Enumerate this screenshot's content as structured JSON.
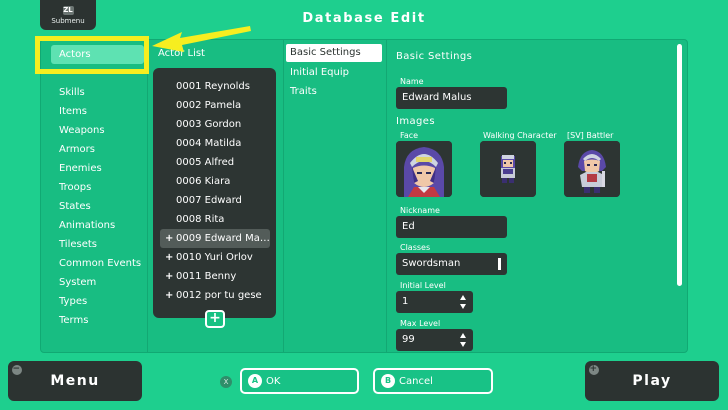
{
  "header": {
    "submenu_key": "ZL",
    "submenu_label": "Submenu",
    "title": "Database Edit"
  },
  "categories": {
    "active": "Actors",
    "items": [
      "Skills",
      "Items",
      "Weapons",
      "Armors",
      "Enemies",
      "Troops",
      "States",
      "Animations",
      "Tilesets",
      "Common Events",
      "System",
      "Types",
      "Terms"
    ]
  },
  "actor_list": {
    "title": "Actor List",
    "items": [
      {
        "label": "0001 Reynolds"
      },
      {
        "label": "0002 Pamela"
      },
      {
        "label": "0003 Gordon"
      },
      {
        "label": "0004 Matilda"
      },
      {
        "label": "0005 Alfred"
      },
      {
        "label": "0006 Kiara"
      },
      {
        "label": "0007 Edward"
      },
      {
        "label": "0008 Rita"
      },
      {
        "label": "0009 Edward Ma…",
        "prefix": "+"
      },
      {
        "label": "0010 Yuri Orlov",
        "prefix": "+"
      },
      {
        "label": "0011 Benny",
        "prefix": "+"
      },
      {
        "label": "0012 por tu gese",
        "prefix": "+"
      }
    ],
    "add_label": "+"
  },
  "tabs": {
    "basic": "Basic Settings",
    "equip": "Initial Equip",
    "traits": "Traits"
  },
  "settings": {
    "title": "Basic Settings",
    "name_label": "Name",
    "name_value": "Edward Malus",
    "images_label": "Images",
    "face_label": "Face",
    "walking_label": "Walking Character",
    "battler_label": "[SV] Battler",
    "nickname_label": "Nickname",
    "nickname_value": "Ed",
    "classes_label": "Classes",
    "classes_value": "Swordsman",
    "initial_level_label": "Initial Level",
    "initial_level_value": "1",
    "max_level_label": "Max Level",
    "max_level_value": "99"
  },
  "footer": {
    "menu_label": "Menu",
    "menu_key": "−",
    "play_label": "Play",
    "play_key": "+",
    "x_key": "X",
    "ok_key": "A",
    "ok_label": "OK",
    "cancel_key": "B",
    "cancel_label": "Cancel"
  },
  "colors": {
    "background": "#1ecf8e",
    "panel_dark": "#2d3533",
    "highlight": "#f6ee20",
    "active_item": "#5ee2b2"
  }
}
